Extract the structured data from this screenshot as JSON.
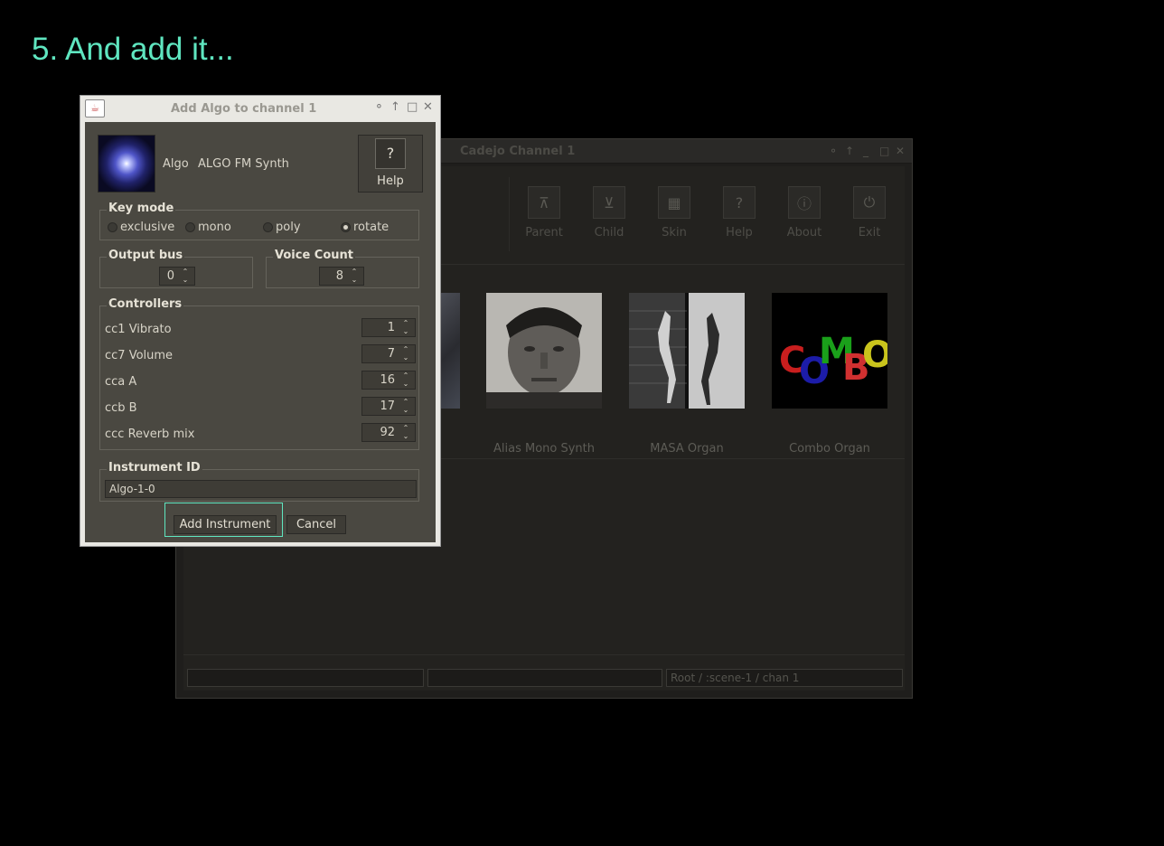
{
  "caption": "5. And add it...",
  "background_window": {
    "title": "Cadejo Channel 1",
    "toolbar": [
      {
        "label": "Parent",
        "icon": "parent-tree-icon"
      },
      {
        "label": "Child",
        "icon": "child-tree-icon"
      },
      {
        "label": "Skin",
        "icon": "skin-icon"
      },
      {
        "label": "Help",
        "icon": "help-icon"
      },
      {
        "label": "About",
        "icon": "info-icon"
      },
      {
        "label": "Exit",
        "icon": "power-icon"
      }
    ],
    "instruments": [
      {
        "label": "Alias Mono Synth"
      },
      {
        "label": "MASA Organ"
      },
      {
        "label": "Combo Organ",
        "logo_text": "COMBO"
      }
    ],
    "status_path": "Root / :scene-1 / chan 1"
  },
  "dialog": {
    "title": "Add Algo to channel 1",
    "instrument_name": "Algo",
    "instrument_desc": "ALGO FM Synth",
    "help_label": "Help",
    "key_mode": {
      "label": "Key mode",
      "options": [
        "exclusive",
        "mono",
        "poly",
        "rotate"
      ],
      "selected": "rotate"
    },
    "output_bus": {
      "label": "Output bus",
      "value": "0"
    },
    "voice_count": {
      "label": "Voice Count",
      "value": "8"
    },
    "controllers": {
      "label": "Controllers",
      "items": [
        {
          "label": "cc1 Vibrato",
          "value": "1"
        },
        {
          "label": "cc7 Volume",
          "value": "7"
        },
        {
          "label": "cca A",
          "value": "16"
        },
        {
          "label": "ccb B",
          "value": "17"
        },
        {
          "label": "ccc Reverb mix",
          "value": "92"
        }
      ]
    },
    "instrument_id": {
      "label": "Instrument ID",
      "value": "Algo-1-0"
    },
    "add_label": "Add Instrument",
    "cancel_label": "Cancel"
  }
}
